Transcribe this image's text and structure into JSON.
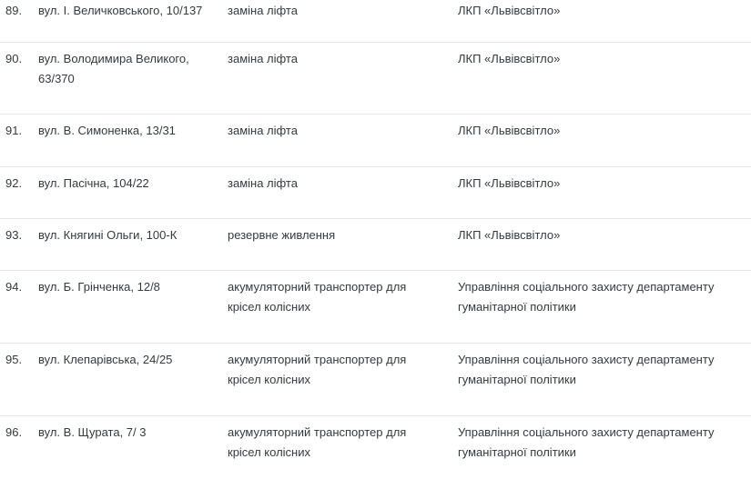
{
  "rows": [
    {
      "num": "89.",
      "address": [
        "вул. І. Величковського, 10/137"
      ],
      "work": [
        "заміна ліфта"
      ],
      "org": [
        "ЛКП «Львівсвітло»"
      ]
    },
    {
      "num": "90.",
      "address": [
        "вул. Володимира Великого,",
        "63/370"
      ],
      "work": [
        "заміна ліфта"
      ],
      "org": [
        "ЛКП «Львівсвітло»"
      ]
    },
    {
      "num": "91.",
      "address": [
        "вул. В. Симоненка, 13/31"
      ],
      "work": [
        "заміна ліфта"
      ],
      "org": [
        "ЛКП «Львівсвітло»"
      ]
    },
    {
      "num": "92.",
      "address": [
        "вул. Пасічна, 104/22"
      ],
      "work": [
        "заміна ліфта"
      ],
      "org": [
        "ЛКП «Львівсвітло»"
      ]
    },
    {
      "num": "93.",
      "address": [
        "вул. Княгині Ольги, 100-К"
      ],
      "work": [
        "резервне живлення"
      ],
      "org": [
        "ЛКП «Львівсвітло»"
      ]
    },
    {
      "num": "94.",
      "address": [
        "вул. Б. Грінченка, 12/8"
      ],
      "work": [
        "акумуляторний транспортер для",
        "крісел колісних"
      ],
      "org": [
        "Управління соціального захисту департаменту",
        "гуманітарної політики"
      ]
    },
    {
      "num": "95.",
      "address": [
        "вул. Клепарівська, 24/25"
      ],
      "work": [
        "акумуляторний транспортер для",
        "крісел колісних"
      ],
      "org": [
        "Управління соціального захисту департаменту",
        "гуманітарної політики"
      ]
    },
    {
      "num": "96.",
      "address": [
        "вул. В. Щурата, 7/ 3"
      ],
      "work": [
        "акумуляторний транспортер для",
        "крісел колісних"
      ],
      "org": [
        "Управління соціального захисту департаменту",
        "гуманітарної політики"
      ]
    }
  ]
}
